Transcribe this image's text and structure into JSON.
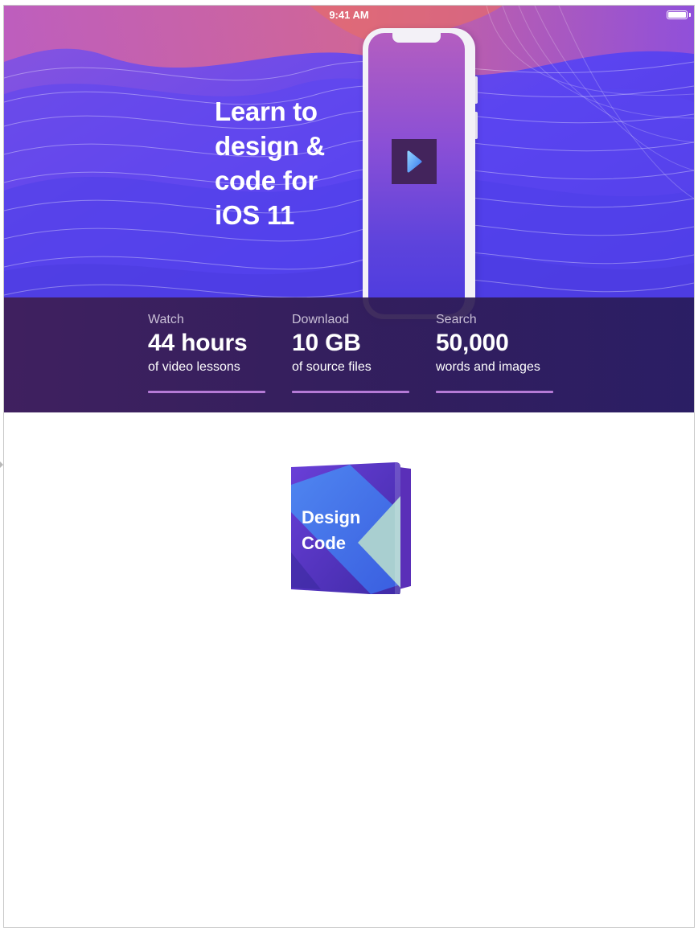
{
  "status_bar": {
    "time": "9:41 AM"
  },
  "hero": {
    "headline_lines": [
      "Learn to",
      "design &",
      "code for",
      "iOS 11"
    ]
  },
  "stats": [
    {
      "label": "Watch",
      "value": "44 hours",
      "description": "of video lessons"
    },
    {
      "label": "Downlaod",
      "value": "10 GB",
      "description": "of source files"
    },
    {
      "label": "Search",
      "value": "50,000",
      "description": "words and images"
    }
  ],
  "logo": {
    "line1": "Design",
    "line2": "Code"
  },
  "colors": {
    "hero_accent": "#5a3ff0",
    "stats_background": "#30204f",
    "underline": "#b57ad6",
    "play_button": "#43245c"
  },
  "icons": {
    "play": "play-triangle-icon",
    "battery": "battery-icon"
  }
}
